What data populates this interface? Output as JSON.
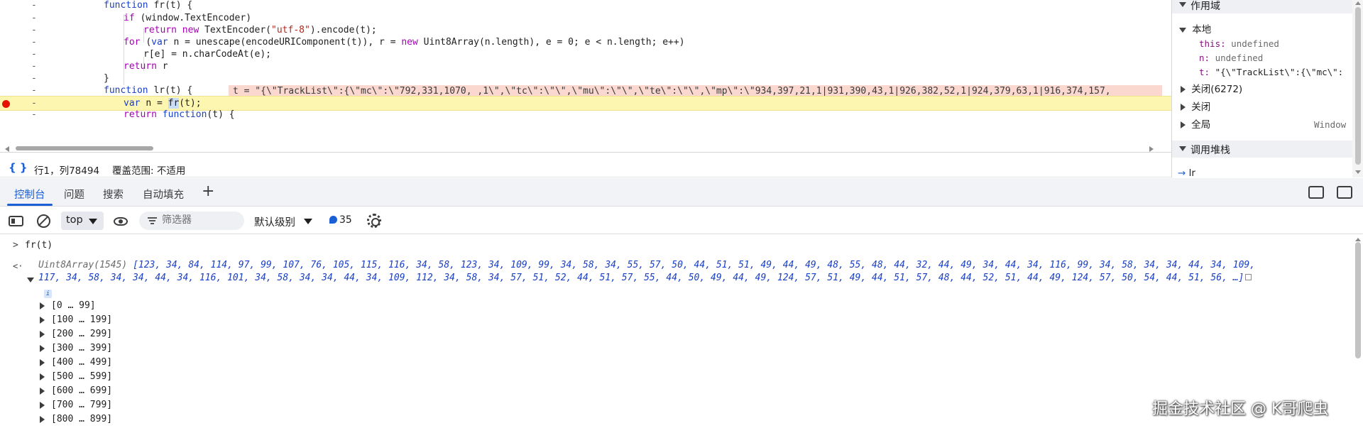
{
  "source": {
    "lines": [
      {
        "indent": 146,
        "parts": [
          [
            "kw2",
            "function "
          ],
          [
            "fn",
            "fr(t) {"
          ]
        ]
      },
      {
        "indent": 174,
        "parts": [
          [
            "kw",
            "if "
          ],
          [
            "fn",
            "(window.TextEncoder)"
          ]
        ]
      },
      {
        "indent": 202,
        "parts": [
          [
            "kw",
            "return new "
          ],
          [
            "fn",
            "TextEncoder("
          ],
          [
            "str",
            "\"utf-8\""
          ],
          [
            "fn",
            ").encode(t);"
          ]
        ]
      },
      {
        "indent": 174,
        "parts": [
          [
            "kw",
            "for "
          ],
          [
            "fn",
            "("
          ],
          [
            "kw2",
            "var "
          ],
          [
            "fn",
            "n = unescape(encodeURIComponent(t)), r = "
          ],
          [
            "kw",
            "new "
          ],
          [
            "fn",
            "Uint8Array(n.length), e = 0; e < n.length; e++)"
          ]
        ]
      },
      {
        "indent": 202,
        "parts": [
          [
            "fn",
            "r[e] = n.charCodeAt(e);"
          ]
        ]
      },
      {
        "indent": 174,
        "parts": [
          [
            "kw",
            "return "
          ],
          [
            "fn",
            "r"
          ]
        ]
      },
      {
        "indent": 146,
        "parts": [
          [
            "fn",
            "}"
          ]
        ]
      },
      {
        "indent": 146,
        "parts": [
          [
            "kw2",
            "function "
          ],
          [
            "fn",
            "lr(t) {"
          ]
        ]
      },
      {
        "indent": 174,
        "parts": [
          [
            "kw2",
            "var "
          ],
          [
            "fn",
            "n = "
          ]
        ]
      },
      {
        "indent": 174,
        "parts": [
          [
            "kw",
            "return "
          ],
          [
            "kw2",
            "function"
          ],
          [
            "fn",
            "(t) {"
          ]
        ]
      }
    ],
    "gutter_mark": "-",
    "inline_value": "t = \"{\\\"TrackList\\\":{\\\"mc\\\":\\\"792,331,1070, ,1\\\",\\\"tc\\\":\\\"\\\",\\\"mu\\\":\\\"\\\",\\\"te\\\":\\\"\\\",\\\"mp\\\":\\\"934,397,21,1|931,390,43,1|926,382,52,1|924,379,63,1|916,374,157,",
    "paused_call": "fr",
    "paused_rest": "(t);"
  },
  "status_bar": {
    "braces": "{ }",
    "position": "行1，列78494",
    "coverage": "覆盖范围: 不适用"
  },
  "sidebar": {
    "scope_header": "作用域",
    "local_label": "本地",
    "props": [
      {
        "name": "this",
        "sep": ": ",
        "value": "undefined",
        "kind": "gray"
      },
      {
        "name": "n",
        "sep": ": ",
        "value": "undefined",
        "kind": "gray"
      },
      {
        "name": "t",
        "sep": ": ",
        "value": "\"{\\\"TrackList\\\":{\\\"mc\\\":",
        "kind": "str"
      }
    ],
    "closure1": "关闭(6272)",
    "closure2": "关闭",
    "global_label": "全局",
    "global_value": "Window",
    "callstack_header": "调用堆栈",
    "callstack_frame": "lr"
  },
  "drawer": {
    "tabs": [
      "控制台",
      "问题",
      "搜索",
      "自动填充"
    ],
    "active_tab": 0,
    "plus": "+"
  },
  "toolbar": {
    "context": "top",
    "filter_placeholder": "筛选器",
    "levels": "默认级别",
    "issues_count": "35"
  },
  "console": {
    "prompt_chevron": ">",
    "input": "fr(t)",
    "result_chevron": "<·",
    "type": "Uint8Array(1545)",
    "line1": "[123, 34, 84, 114, 97, 99, 107, 76, 105, 115, 116, 34, 58, 123, 34, 109, 99, 34, 58, 34, 55, 57, 50, 44, 51, 51, 49, 44, 49, 48, 55, 48, 44, 32, 44, 49, 34, 44, 34, 116, 99, 34, 58, 34, 34, 44, 34, 109,",
    "line2": "117, 34, 58, 34, 34, 44, 34, 116, 101, 34, 58, 34, 34, 44, 34, 109, 112, 34, 58, 34, 57, 51, 52, 44, 51, 57, 55, 44, 50, 49, 44, 49, 124, 57, 51, 49, 44, 51, 57, 48, 44, 52, 51, 44, 49, 124, 57, 50, 54, 44, 51, 56, …]",
    "info": "i",
    "ranges": [
      "[0 … 99]",
      "[100 … 199]",
      "[200 … 299]",
      "[300 … 399]",
      "[400 … 499]",
      "[500 … 599]",
      "[600 … 699]",
      "[700 … 799]",
      "[800 … 899]"
    ]
  },
  "watermark": "掘金技术社区 @ K哥爬虫",
  "colors": {
    "accent": "#1a5fd6",
    "breakpoint": "#e51400",
    "paused_line": "#fdf6b0",
    "inline_value_bg": "#fad7cf"
  }
}
